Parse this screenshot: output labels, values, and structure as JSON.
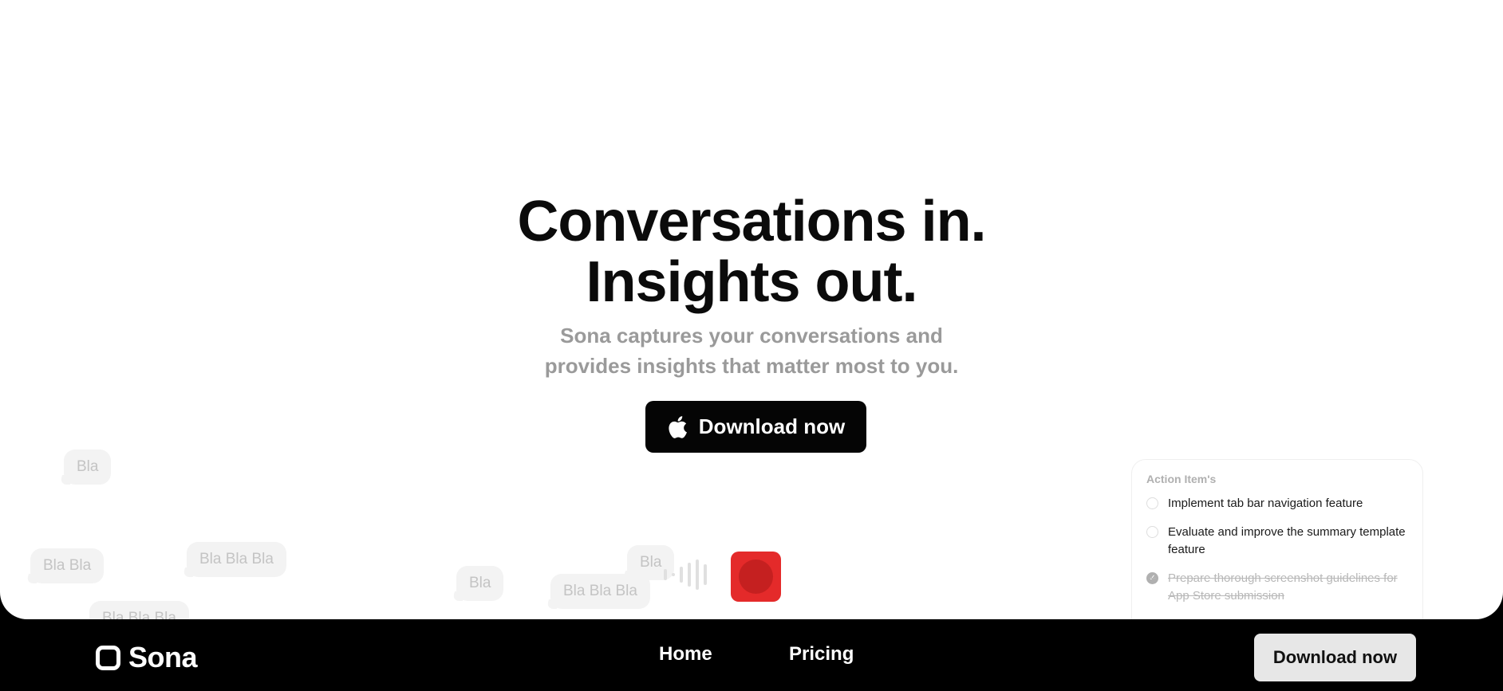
{
  "hero": {
    "headline_line1": "Conversations in.",
    "headline_line2": "Insights out.",
    "subhead_line1": "Sona captures your conversations and",
    "subhead_line2": "provides insights that matter most to you.",
    "cta_label": "Download now",
    "cta_icon": "apple-icon"
  },
  "bubbles": [
    "Bla",
    "Bla Bla",
    "Bla Bla Bla",
    "Bla Bla Bla",
    "Bla",
    "Bla",
    "Bla Bla Bla"
  ],
  "action_items": {
    "title": "Action Item's",
    "items": [
      {
        "text": "Implement tab bar navigation feature",
        "done": false
      },
      {
        "text": "Evaluate and improve the summary template feature",
        "done": false
      },
      {
        "text": "Prepare thorough screenshot guidelines for App Store submission",
        "done": true
      }
    ]
  },
  "recorder": {
    "icon": "record-icon",
    "color": "#e42a2a"
  },
  "footer": {
    "brand": "Sona",
    "nav": [
      {
        "label": "Home"
      },
      {
        "label": "Pricing"
      }
    ],
    "cta_label": "Download now"
  }
}
